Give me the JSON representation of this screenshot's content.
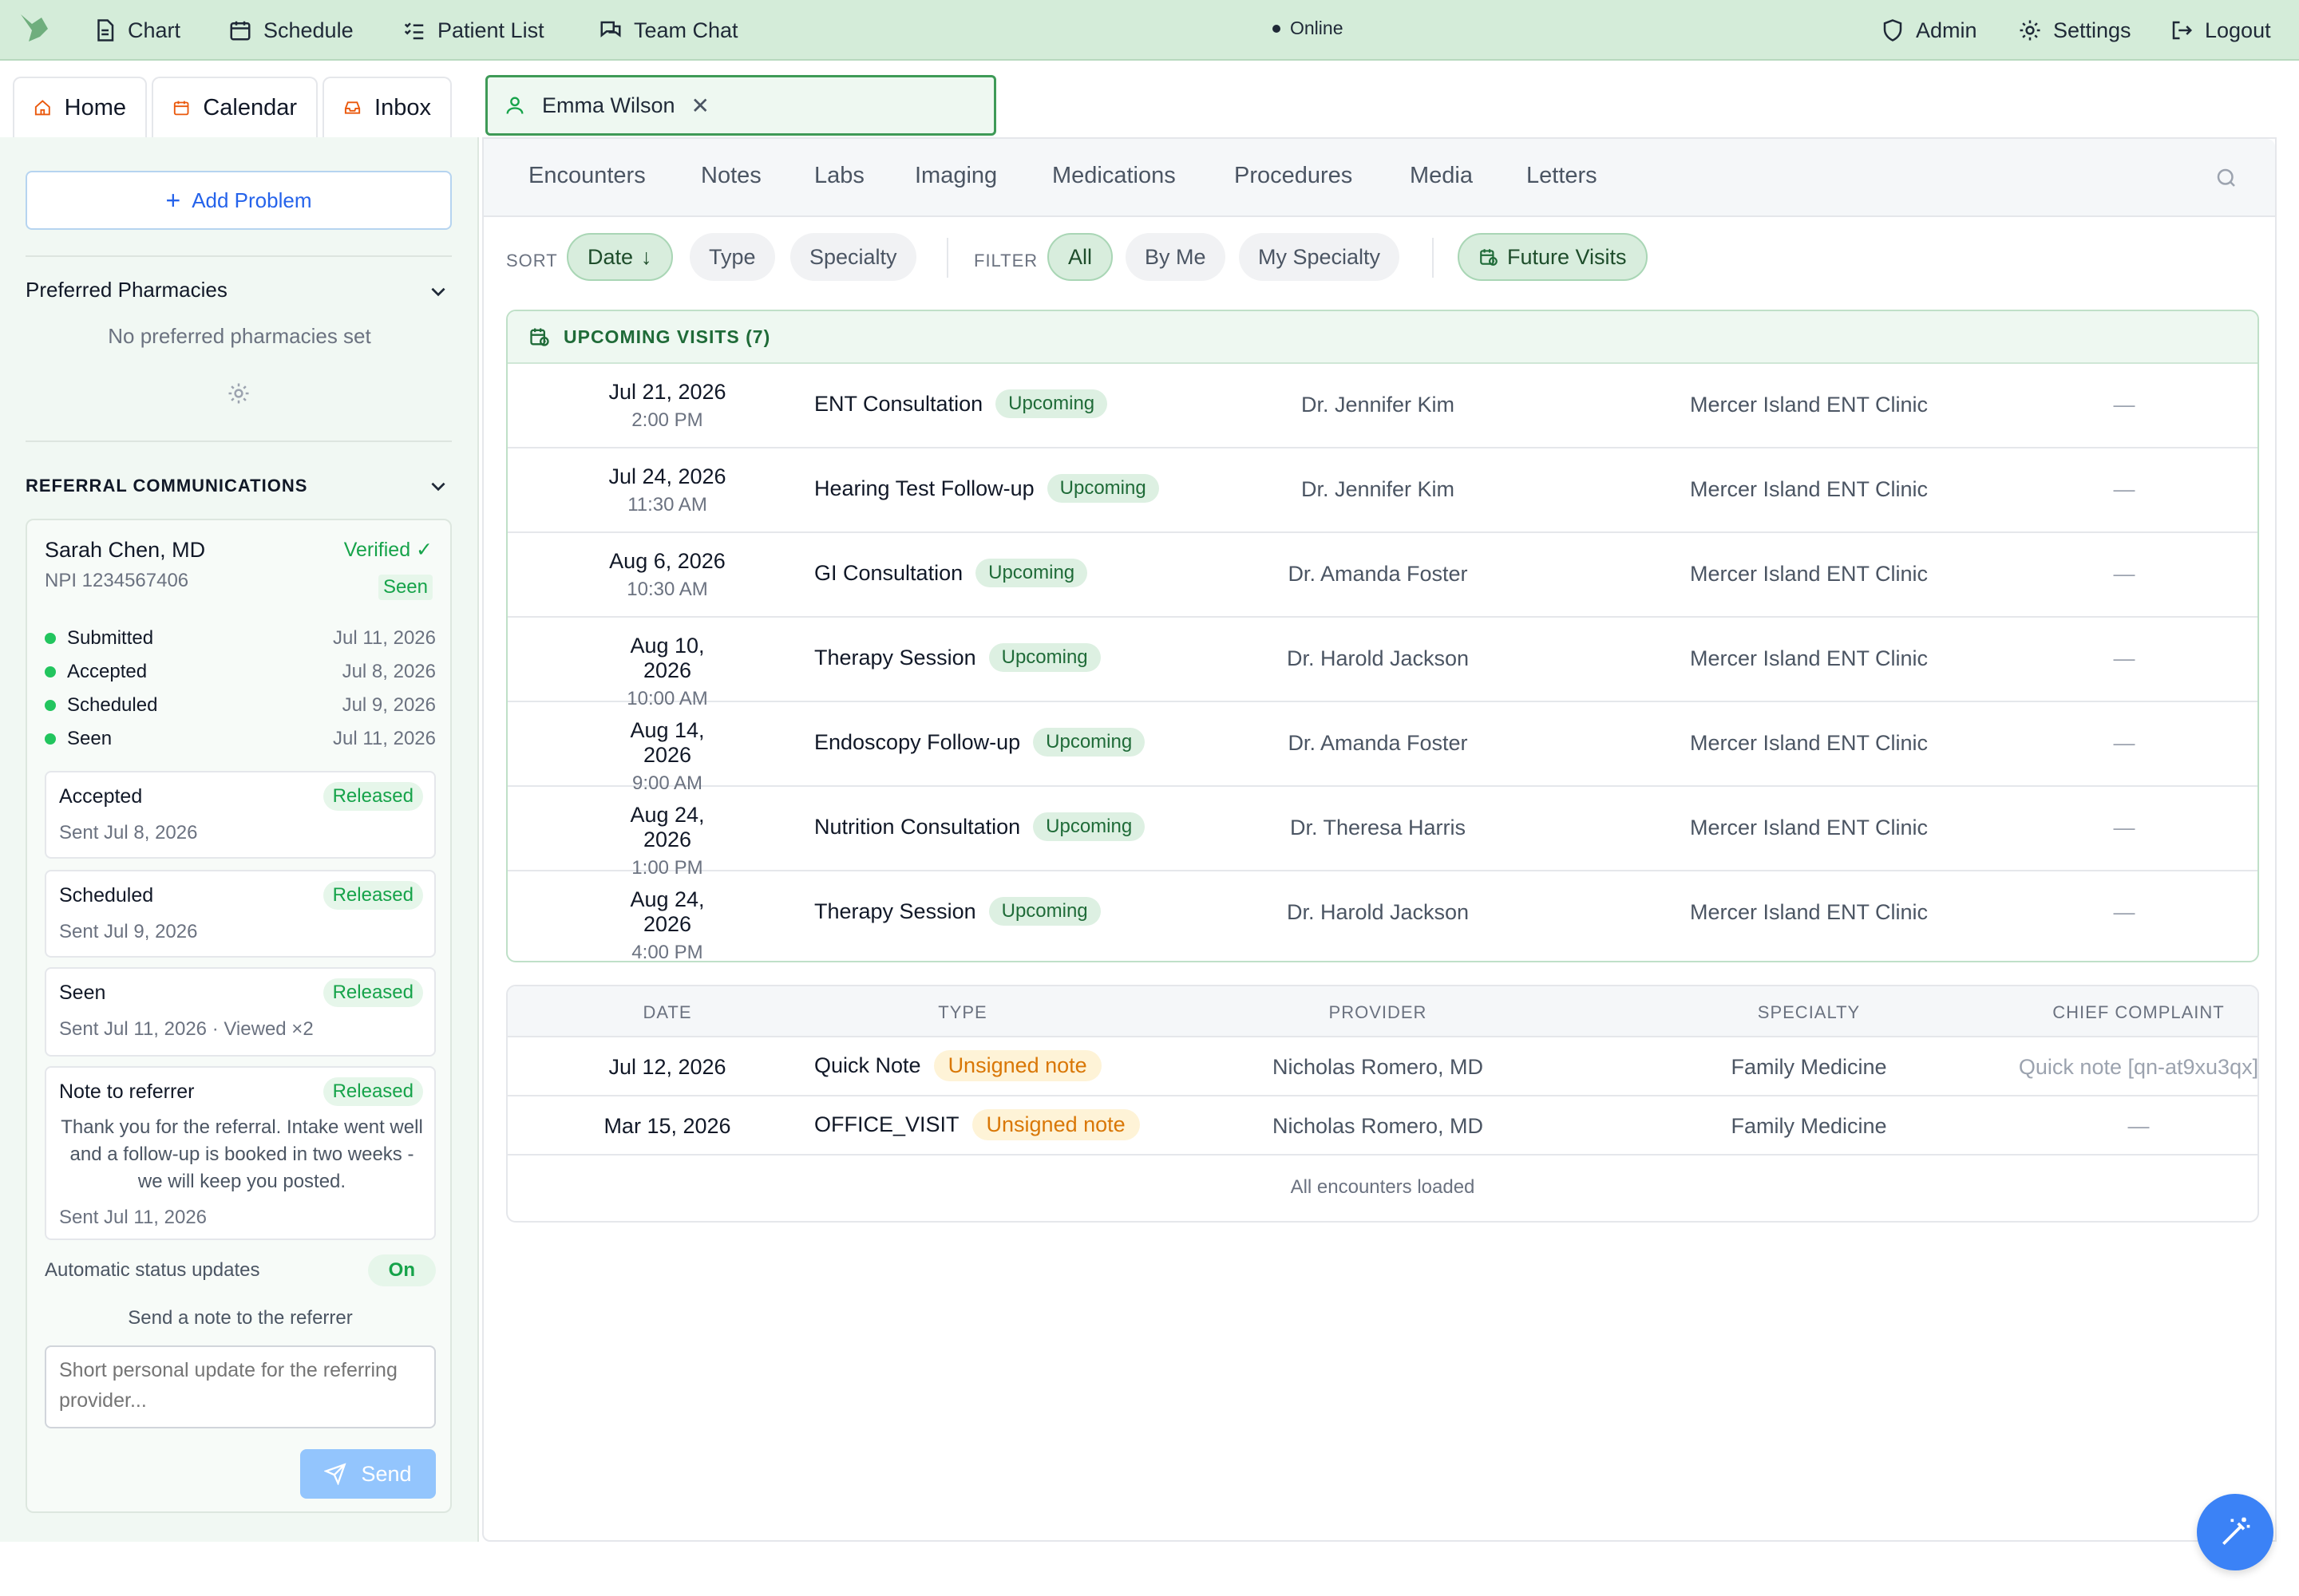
{
  "topbar": {
    "nav": [
      {
        "label": "Chart",
        "icon": "document-icon"
      },
      {
        "label": "Schedule",
        "icon": "calendar-icon"
      },
      {
        "label": "Patient List",
        "icon": "list-icon"
      },
      {
        "label": "Team Chat",
        "icon": "chat-icon"
      }
    ],
    "status": "Online",
    "right": [
      {
        "label": "Admin",
        "icon": "shield-icon"
      },
      {
        "label": "Settings",
        "icon": "gear-icon"
      },
      {
        "label": "Logout",
        "icon": "logout-icon"
      }
    ]
  },
  "tabs": {
    "home": "Home",
    "calendar": "Calendar",
    "inbox": "Inbox",
    "patient": "Emma Wilson"
  },
  "sidebar": {
    "add_problem": "Add Problem",
    "pharmacies_title": "Preferred Pharmacies",
    "pharmacies_empty": "No preferred pharmacies set",
    "referral_title": "REFERRAL COMMUNICATIONS",
    "referral": {
      "name": "Sarah Chen, MD",
      "npi": "NPI 1234567406",
      "verified": "Verified ✓",
      "seen": "Seen",
      "timeline": [
        {
          "label": "Submitted",
          "date": "Jul 11, 2026"
        },
        {
          "label": "Accepted",
          "date": "Jul 8, 2026"
        },
        {
          "label": "Scheduled",
          "date": "Jul 9, 2026"
        },
        {
          "label": "Seen",
          "date": "Jul 11, 2026"
        }
      ],
      "messages": [
        {
          "title": "Accepted",
          "status": "Released",
          "sent": "Sent Jul 8, 2026"
        },
        {
          "title": "Scheduled",
          "status": "Released",
          "sent": "Sent Jul 9, 2026"
        },
        {
          "title": "Seen",
          "status": "Released",
          "sent": "Sent Jul 11, 2026 · Viewed ×2"
        },
        {
          "title": "Note to referrer",
          "status": "Released",
          "body": "Thank you for the referral. Intake went well and a follow-up is booked in two weeks - we will keep you posted.",
          "sent": "Sent Jul 11, 2026"
        }
      ],
      "auto_updates_label": "Automatic status updates",
      "auto_updates_value": "On",
      "send_note_label": "Send a note to the referrer",
      "note_placeholder": "Short personal update for the referring provider...",
      "send_button": "Send"
    }
  },
  "content_tabs": [
    "Encounters",
    "Notes",
    "Labs",
    "Imaging",
    "Medications",
    "Procedures",
    "Media",
    "Letters"
  ],
  "filters": {
    "sort_label": "SORT",
    "sort": [
      "Date",
      "Type",
      "Specialty"
    ],
    "filter_label": "FILTER",
    "filter": [
      "All",
      "By Me",
      "My Specialty"
    ],
    "future": "Future Visits"
  },
  "upcoming": {
    "title": "UPCOMING VISITS (7)",
    "rows": [
      {
        "date": "Jul 21, 2026",
        "time": "2:00 PM",
        "type": "ENT Consultation",
        "badge": "Upcoming",
        "provider": "Dr. Jennifer Kim",
        "specialty": "Mercer Island ENT Clinic",
        "complaint": "—"
      },
      {
        "date": "Jul 24, 2026",
        "time": "11:30 AM",
        "type": "Hearing Test Follow-up",
        "badge": "Upcoming",
        "provider": "Dr. Jennifer Kim",
        "specialty": "Mercer Island ENT Clinic",
        "complaint": "—"
      },
      {
        "date": "Aug 6, 2026",
        "time": "10:30 AM",
        "type": "GI Consultation",
        "badge": "Upcoming",
        "provider": "Dr. Amanda Foster",
        "specialty": "Mercer Island ENT Clinic",
        "complaint": "—"
      },
      {
        "date": "Aug 10, 2026",
        "time": "10:00 AM",
        "type": "Therapy Session",
        "badge": "Upcoming",
        "provider": "Dr. Harold Jackson",
        "specialty": "Mercer Island ENT Clinic",
        "complaint": "—"
      },
      {
        "date": "Aug 14, 2026",
        "time": "9:00 AM",
        "type": "Endoscopy Follow-up",
        "badge": "Upcoming",
        "provider": "Dr. Amanda Foster",
        "specialty": "Mercer Island ENT Clinic",
        "complaint": "—"
      },
      {
        "date": "Aug 24, 2026",
        "time": "1:00 PM",
        "type": "Nutrition Consultation",
        "badge": "Upcoming",
        "provider": "Dr. Theresa Harris",
        "specialty": "Mercer Island ENT Clinic",
        "complaint": "—"
      },
      {
        "date": "Aug 24, 2026",
        "time": "4:00 PM",
        "type": "Therapy Session",
        "badge": "Upcoming",
        "provider": "Dr. Harold Jackson",
        "specialty": "Mercer Island ENT Clinic",
        "complaint": "—"
      }
    ]
  },
  "encounters": {
    "headers": [
      "DATE",
      "TYPE",
      "PROVIDER",
      "SPECIALTY",
      "CHIEF COMPLAINT"
    ],
    "rows": [
      {
        "date": "Jul 12, 2026",
        "type": "Quick Note",
        "badge": "Unsigned note",
        "provider": "Nicholas Romero, MD",
        "specialty": "Family Medicine",
        "complaint": "Quick note [qn-at9xu3qx]"
      },
      {
        "date": "Mar 15, 2026",
        "type": "OFFICE_VISIT",
        "badge": "Unsigned note",
        "provider": "Nicholas Romero, MD",
        "specialty": "Family Medicine",
        "complaint": "—"
      }
    ],
    "footer": "All encounters loaded"
  },
  "colors": {
    "topbar_bg": "#d4ecd9",
    "accent_green": "#16a34a",
    "accent_blue": "#2563eb",
    "unsigned": "#d97706"
  }
}
